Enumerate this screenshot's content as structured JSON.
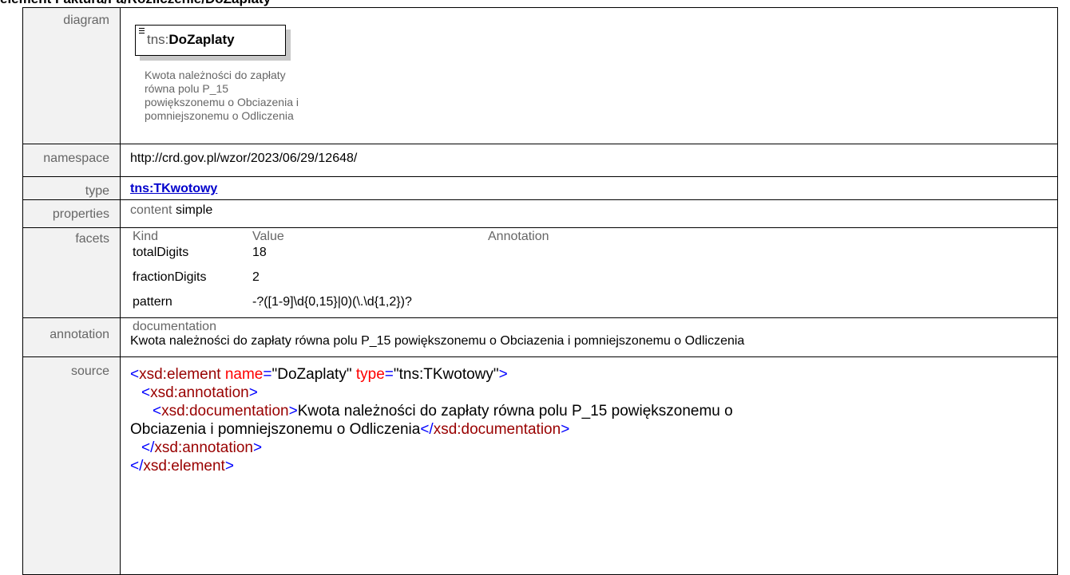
{
  "title": "element Faktura/Fa/Rozliczenie/DoZaplaty",
  "labels": {
    "diagram": "diagram",
    "namespace": "namespace",
    "type": "type",
    "properties": "properties",
    "facets": "facets",
    "annotation": "annotation",
    "source": "source"
  },
  "diagram": {
    "prefix": "tns:",
    "name": "DoZaplaty",
    "doc_lines": [
      "Kwota należności do zapłaty",
      "równa polu P_15",
      "powiększonemu o Obciazenia i",
      "pomniejszonemu o Odliczenia"
    ]
  },
  "namespace": "http://crd.gov.pl/wzor/2023/06/29/12648/",
  "type": "tns:TKwotowy",
  "properties": {
    "key": "content",
    "value": "simple"
  },
  "facets": {
    "headers": [
      "Kind",
      "Value",
      "Annotation"
    ],
    "rows": [
      {
        "kind": "totalDigits",
        "value": "18",
        "annotation": ""
      },
      {
        "kind": "fractionDigits",
        "value": "2",
        "annotation": ""
      },
      {
        "kind": "pattern",
        "value": "-?([1-9]\\d{0,15}|0)(\\.\\d{1,2})?",
        "annotation": ""
      }
    ]
  },
  "annotation": {
    "key": "documentation",
    "value": "Kwota należności do zapłaty równa polu P_15 powiększonemu o Obciazenia i pomniejszonemu o Odliczenia"
  },
  "source": {
    "open_tag": "xsd:element",
    "attr1_name": "name",
    "attr1_value": "\"DoZaplaty\"",
    "attr2_name": "type",
    "attr2_value": "\"tns:TKwotowy\"",
    "annotation_tag": "xsd:annotation",
    "documentation_tag": "xsd:documentation",
    "doc_text_1": "Kwota należności do zapłaty równa polu P_15 powiększonemu o",
    "doc_text_2": "Obciazenia i pomniejszonemu o Odliczenia"
  }
}
